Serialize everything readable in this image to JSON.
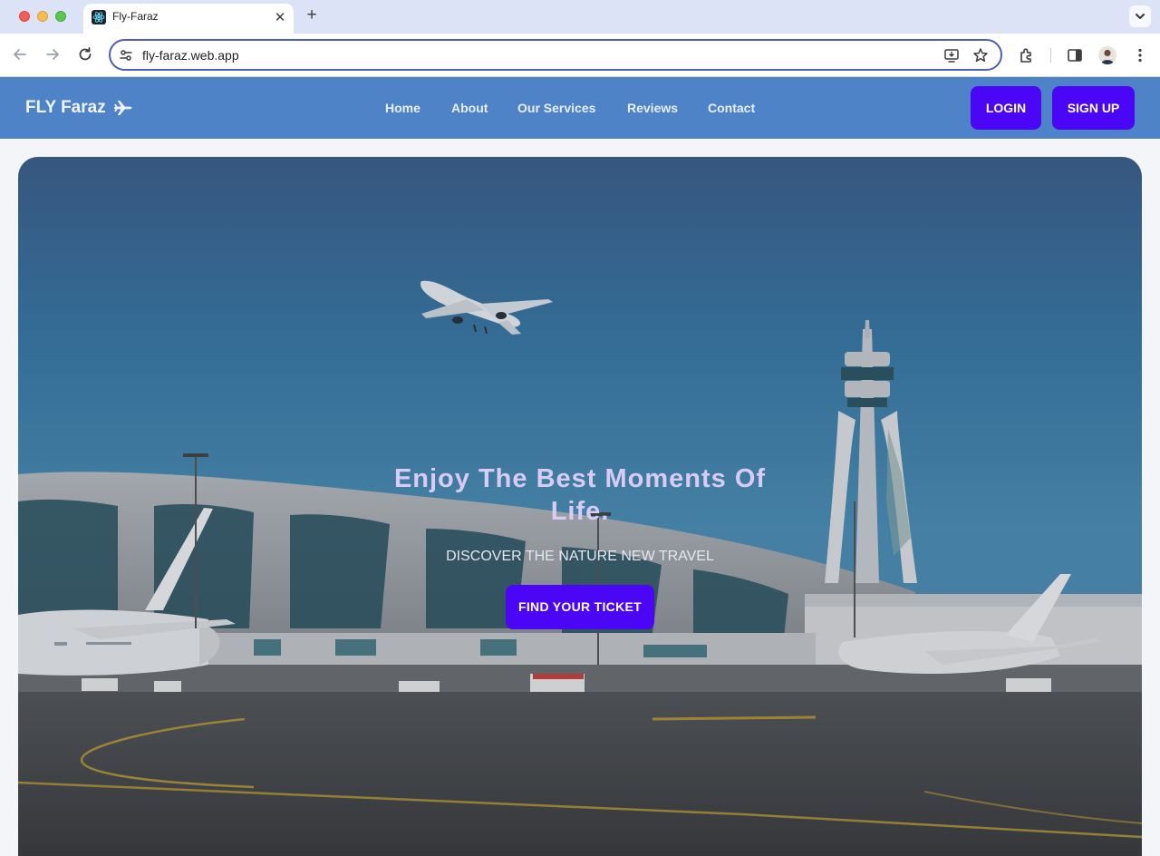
{
  "browser": {
    "tab": {
      "title": "Fly-Faraz",
      "favicon": "react-icon"
    },
    "address_bar": {
      "url": "fly-faraz.web.app"
    },
    "icons": [
      "back-icon",
      "forward-icon",
      "reload-icon",
      "site-info-icon",
      "install-app-icon",
      "bookmark-star-icon",
      "extensions-icon",
      "side-panel-icon",
      "profile-avatar",
      "menu-icon"
    ]
  },
  "site": {
    "brand": "FLY Faraz",
    "brand_icon": "airplane-icon",
    "nav": {
      "home": "Home",
      "about": "About",
      "services": "Our Services",
      "reviews": "Reviews",
      "contact": "Contact"
    },
    "auth": {
      "login": "LOGIN",
      "signup": "SIGN UP"
    }
  },
  "hero": {
    "title": "Enjoy The Best Moments Of Life.",
    "subtitle": "DISCOVER THE NATURE NEW TRAVEL",
    "cta": "FIND YOUR TICKET"
  },
  "colors": {
    "nav_bg": "#4f83c8",
    "accent": "#4b07f5",
    "hero_title": "#d8ccf6",
    "sky": "#3a7aa6"
  }
}
